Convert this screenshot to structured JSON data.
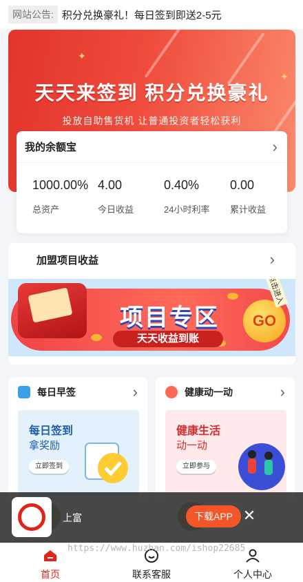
{
  "notice": {
    "tag": "网站公告:",
    "text": "积分兑换豪礼！每日签到即送2-5元"
  },
  "banner": {
    "title": "天天来签到 积分兑换豪礼",
    "subtitle": "投放自助售货机 让普通投资者轻松获利"
  },
  "wallet": {
    "title": "我的余额宝",
    "stats": [
      {
        "value": "1000.00%",
        "label": "总资产"
      },
      {
        "value": "4.00",
        "label": "今日收益"
      },
      {
        "value": "0.40%",
        "label": "24小时利率"
      },
      {
        "value": "0.00",
        "label": "累计收益"
      }
    ]
  },
  "project": {
    "title": "加盟项目收益",
    "banner_title": "项目专区",
    "banner_sub": "天天收益到账",
    "go": "GO",
    "enter": "点击进入"
  },
  "cards": [
    {
      "title": "每日早签",
      "body_title": "每日签到",
      "body_sub": "拿奖励",
      "button": "立即签到",
      "accent": "#1f5fa8"
    },
    {
      "title": "健康动一动",
      "body_title": "健康生活",
      "body_sub": "动一动",
      "button": "立即参与",
      "accent": "#e53935"
    }
  ],
  "app_banner": {
    "name": "上富",
    "download": "下载APP",
    "close": "✕"
  },
  "watermark": "https://www.huzhan.com/ishop22685",
  "tabs": [
    {
      "label": "首页",
      "icon": "home-icon",
      "active": true
    },
    {
      "label": "联系客服",
      "icon": "customer-service-icon",
      "active": false
    },
    {
      "label": "个人中心",
      "icon": "user-icon",
      "active": false
    }
  ],
  "colors": {
    "brand_red": "#e2231a",
    "download_orange": "#f4562a"
  }
}
